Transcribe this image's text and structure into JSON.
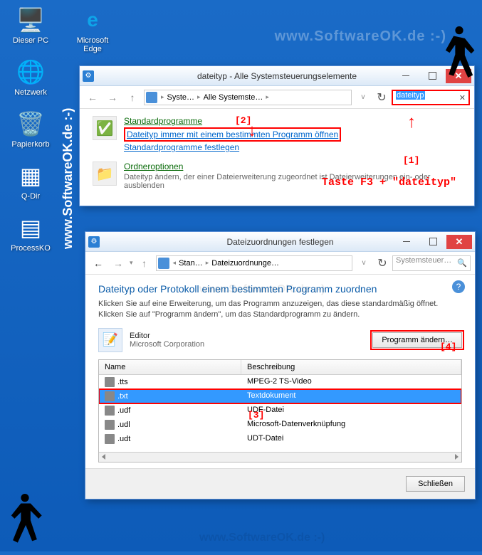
{
  "watermark": "www.SoftwareOK.de :-)",
  "desktop": {
    "col1": [
      {
        "label": "Dieser PC",
        "icon": "🖥️"
      },
      {
        "label": "Netzwerk",
        "icon": "🌐"
      },
      {
        "label": "Papierkorb",
        "icon": "🗑️"
      },
      {
        "label": "Q-Dir",
        "icon": "▦"
      },
      {
        "label": "ProcessKO",
        "icon": "▤"
      }
    ],
    "col2": [
      {
        "label": "Microsoft Edge",
        "icon": "e"
      }
    ]
  },
  "window1": {
    "title": "dateityp - Alle Systemsteuerungselemente",
    "breadcrumb": [
      "Syste…",
      "Alle Systemste…"
    ],
    "search_value": "dateityp",
    "result1": {
      "title": "Standardprogramme",
      "link1": "Dateityp immer mit einem bestimmten Programm öffnen",
      "link2": "Standardprogramme festlegen"
    },
    "result2": {
      "title": "Ordneroptionen",
      "desc": "Dateityp ändern, der einer Dateierweiterung zugeordnet ist Dateierweiterungen ein- oder ausblenden"
    }
  },
  "annotations": {
    "n1": "[1]",
    "n2": "[2]",
    "n3": "[3]",
    "n4": "[4]",
    "hint": "Taste F3 + \"dateityp\""
  },
  "window2": {
    "title": "Dateizuordnungen festlegen",
    "breadcrumb": [
      "Stan…",
      "Dateizuordnunge…"
    ],
    "search_placeholder": "Systemsteuer…",
    "heading": "Dateityp oder Protokoll einem bestimmten Programm zuordnen",
    "instruction": "Klicken Sie auf eine Erweiterung, um das Programm anzuzeigen, das diese standardmäßig öffnet. Klicken Sie auf \"Programm ändern\", um das Standardprogramm zu ändern.",
    "program_name": "Editor",
    "program_company": "Microsoft Corporation",
    "change_button": "Programm ändern…",
    "columns": {
      "name": "Name",
      "desc": "Beschreibung"
    },
    "rows": [
      {
        "ext": ".tts",
        "desc": "MPEG-2 TS-Video",
        "sel": false
      },
      {
        "ext": ".txt",
        "desc": "Textdokument",
        "sel": true
      },
      {
        "ext": ".udf",
        "desc": "UDF-Datei",
        "sel": false
      },
      {
        "ext": ".udl",
        "desc": "Microsoft-Datenverknüpfung",
        "sel": false
      },
      {
        "ext": ".udt",
        "desc": "UDT-Datei",
        "sel": false
      }
    ],
    "close_button": "Schließen"
  }
}
